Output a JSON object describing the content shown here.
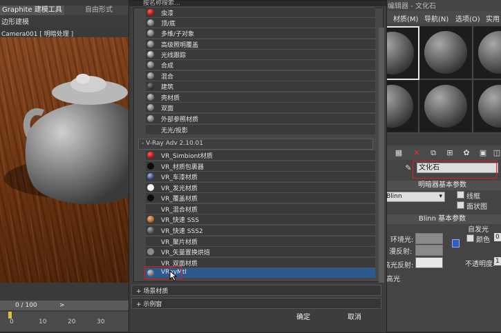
{
  "left_panel": {
    "ribbon_tabs": [
      "Graphite 建模工具",
      "自由形式"
    ],
    "mode_label": "边形建模",
    "viewport_label": "Camera001 [ 明暗处理 ]",
    "frame_counter": "0 / 100",
    "timeline_arrow": ">",
    "ruler_ticks": [
      "0",
      "10",
      "20",
      "30"
    ]
  },
  "dialog": {
    "title": "按名称搜索...",
    "standard_materials": [
      {
        "label": "虫漆",
        "icon": "red-sphere-icon",
        "color": "#b01818"
      },
      {
        "label": "顶/底",
        "icon": "gray-sphere-icon",
        "color": "#777777"
      },
      {
        "label": "多维/子对象",
        "icon": "gray-sphere-icon",
        "color": "#777777"
      },
      {
        "label": "高级照明覆盖",
        "icon": "gray-sphere-icon",
        "color": "#777777"
      },
      {
        "label": "光线跟踪",
        "icon": "raytrace-sphere-icon",
        "color": "#888888"
      },
      {
        "label": "合成",
        "icon": "gray-sphere-icon",
        "color": "#777777"
      },
      {
        "label": "混合",
        "icon": "gray-sphere-icon",
        "color": "#777777"
      },
      {
        "label": "建筑",
        "icon": "dark-sphere-icon",
        "color": "#333333"
      },
      {
        "label": "壳材质",
        "icon": "gray-sphere-icon",
        "color": "#777777"
      },
      {
        "label": "双面",
        "icon": "gray-sphere-icon",
        "color": "#777777"
      },
      {
        "label": "外部参照材质",
        "icon": "gray-sphere-icon",
        "color": "#777777"
      },
      {
        "label": "无光/投影",
        "icon": "none",
        "color": ""
      }
    ],
    "vray_group_header": "- V-Ray Adv 2.10.01",
    "vray_materials": [
      {
        "label": "VR_Simbiont材质",
        "icon": "red-sphere-icon",
        "color": "#b01818"
      },
      {
        "label": "VR_材质包裹器",
        "icon": "black-sphere-icon",
        "color": "#111111"
      },
      {
        "label": "VR_车漆材质",
        "icon": "blue-sphere-icon",
        "color": "#3a4a7a"
      },
      {
        "label": "VR_发光材质",
        "icon": "white-sphere-icon",
        "color": "#f4f4f4"
      },
      {
        "label": "VR_覆盖材质",
        "icon": "black-sphere-icon",
        "color": "#111111"
      },
      {
        "label": "VR_混合材质",
        "icon": "none",
        "color": ""
      },
      {
        "label": "VR_快速 SSS",
        "icon": "orange-sphere-icon",
        "color": "#b86a30"
      },
      {
        "label": "VR_快速 SSS2",
        "icon": "gray-sphere-icon",
        "color": "#666666"
      },
      {
        "label": "VR_聚片材质",
        "icon": "none",
        "color": ""
      },
      {
        "label": "VR_矢量置换烘焙",
        "icon": "gray-sphere-icon",
        "color": "#8a8a8a"
      },
      {
        "label": "VR_双面材质",
        "icon": "none",
        "color": ""
      },
      {
        "label": "VRayMtl",
        "icon": "gray-sphere-icon",
        "color": "#777777"
      }
    ],
    "collapsed_sections": [
      "+ 场景材质",
      "+ 示例窗"
    ],
    "ok_label": "确定",
    "cancel_label": "取消"
  },
  "material_editor": {
    "title": "编辑器 - 文化石",
    "menu": [
      "材质(M)",
      "导航(N)",
      "选项(O)",
      "实用"
    ],
    "material_name": "文化石",
    "rollout_basic_params": "明暗器基本参数",
    "shader_value": "Blinn",
    "wire_label": "线框",
    "faceted_label": "面状图",
    "rollout_blinn": "Blinn 基本参数",
    "self_illum_label": "自发光",
    "color_label": "颜色",
    "color_value": "0",
    "ambient_label": "环境光:",
    "diffuse_label": "漫反射:",
    "specular_label": "高光反射:",
    "opacity_label": "不透明度:",
    "opacity_value": "1",
    "highlight_label": "高光"
  }
}
